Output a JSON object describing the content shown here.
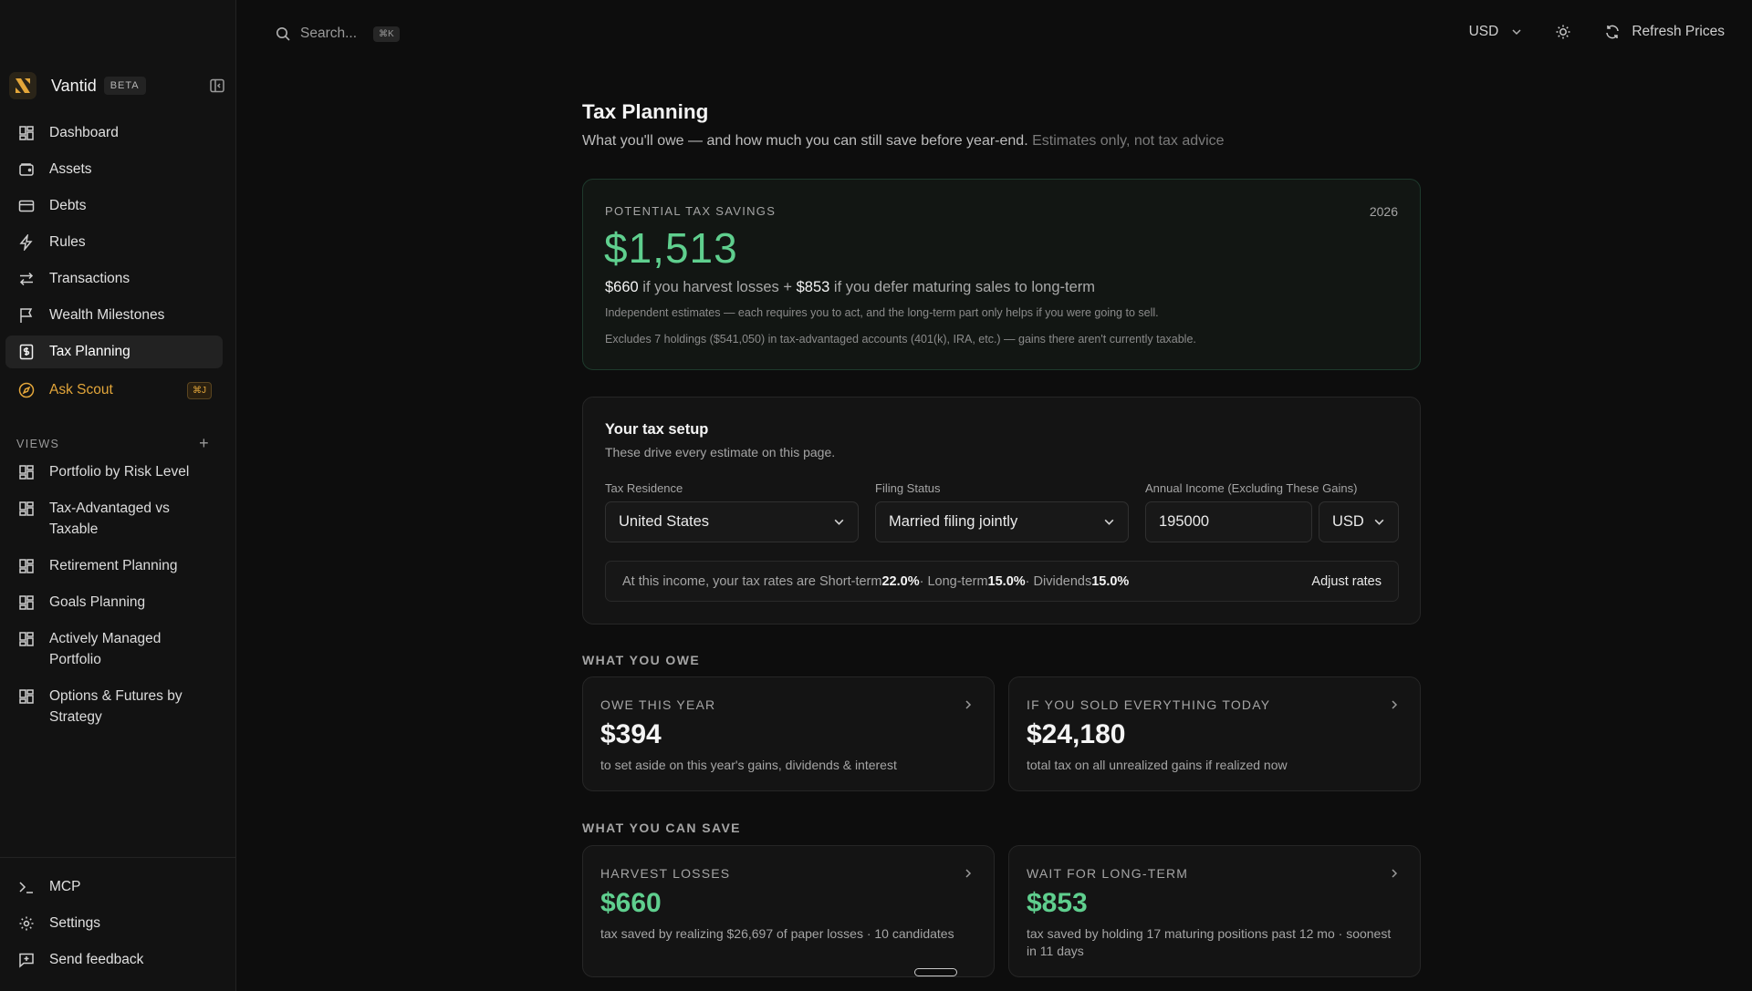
{
  "app": {
    "name": "Vantid",
    "badge": "BETA"
  },
  "icons": {
    "logo": "vantid-logo-icon",
    "collapse": "sidebar-collapse-icon"
  },
  "colors": {
    "accent": "#e3a63a",
    "positive": "#5fcf8e",
    "background": "#0d0d0d"
  },
  "nav": [
    {
      "label": "Dashboard",
      "icon": "grid-icon"
    },
    {
      "label": "Assets",
      "icon": "wallet-icon"
    },
    {
      "label": "Debts",
      "icon": "credit-card-icon"
    },
    {
      "label": "Rules",
      "icon": "lightning-icon"
    },
    {
      "label": "Transactions",
      "icon": "arrows-swap-icon"
    },
    {
      "label": "Wealth Milestones",
      "icon": "flag-icon"
    },
    {
      "label": "Tax Planning",
      "icon": "tax-receipt-icon",
      "active": true
    }
  ],
  "scout": {
    "label": "Ask Scout",
    "shortcut": "⌘J",
    "icon": "compass-icon"
  },
  "views": {
    "heading": "VIEWS",
    "items": [
      "Portfolio by Risk Level",
      "Tax-Advantaged vs Taxable",
      "Retirement Planning",
      "Goals Planning",
      "Actively Managed Portfolio",
      "Options & Futures by Strategy"
    ]
  },
  "bottom_nav": [
    {
      "label": "MCP",
      "icon": "terminal-icon"
    },
    {
      "label": "Settings",
      "icon": "gear-icon"
    },
    {
      "label": "Send feedback",
      "icon": "feedback-icon"
    }
  ],
  "topbar": {
    "search_placeholder": "Search...",
    "search_shortcut": "⌘K",
    "currency": "USD",
    "refresh_label": "Refresh Prices"
  },
  "page": {
    "title": "Tax Planning",
    "subtitle": "What you'll owe — and how much you can still save before year-end.",
    "subtitle_muted": "Estimates only, not tax advice"
  },
  "hero": {
    "label": "POTENTIAL TAX SAVINGS",
    "year": "2026",
    "amount": "$1,513",
    "harvest_amount": "$660",
    "harvest_text": " if you harvest losses + ",
    "defer_amount": "$853",
    "defer_text": " if you defer maturing sales to long-term",
    "note1": "Independent estimates — each requires you to act, and the long-term part only helps if you were going to sell.",
    "note2": "Excludes 7 holdings ($541,050) in tax-advantaged accounts (401(k), IRA, etc.) — gains there aren't currently taxable."
  },
  "setup": {
    "title": "Your tax setup",
    "subtitle": "These drive every estimate on this page.",
    "residence_label": "Tax Residence",
    "residence_value": "United States",
    "filing_label": "Filing Status",
    "filing_value": "Married filing jointly",
    "income_label": "Annual Income (Excluding These Gains)",
    "income_value": "195000",
    "income_currency": "USD",
    "rates_prefix": "At this income, your tax rates are Short-term ",
    "short_term": "22.0%",
    "long_term_label": " · Long-term ",
    "long_term": "15.0%",
    "dividends_label": " · Dividends ",
    "dividends": "15.0%",
    "adjust_label": "Adjust rates"
  },
  "owe": {
    "heading": "WHAT YOU OWE",
    "this_year": {
      "label": "OWE THIS YEAR",
      "value": "$394",
      "desc": "to set aside on this year's gains, dividends & interest"
    },
    "sold_all": {
      "label": "IF YOU SOLD EVERYTHING TODAY",
      "value": "$24,180",
      "desc": "total tax on all unrealized gains if realized now"
    }
  },
  "save": {
    "heading": "WHAT YOU CAN SAVE",
    "harvest": {
      "label": "HARVEST LOSSES",
      "value": "$660",
      "desc": "tax saved by realizing $26,697 of paper losses · 10 candidates"
    },
    "long_term": {
      "label": "WAIT FOR LONG-TERM",
      "value": "$853",
      "desc": "tax saved by holding 17 maturing positions past 12 mo · soonest in 11 days"
    }
  }
}
